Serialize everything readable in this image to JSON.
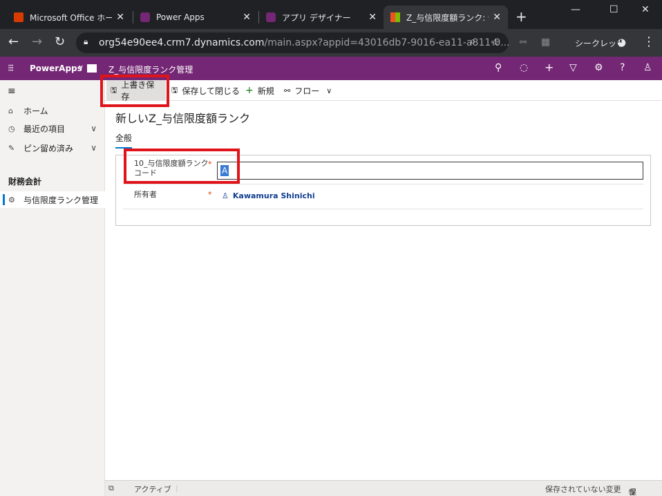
{
  "browser": {
    "tabs": [
      {
        "title": "Microsoft Office ホーム",
        "favicon_color": "#d83b01"
      },
      {
        "title": "Power Apps",
        "favicon_color": "#742774"
      },
      {
        "title": "アプリ デザイナー",
        "favicon_color": "#742774"
      },
      {
        "title": "Z_与信限度額ランク: 情",
        "favicon_color": "#f25022"
      }
    ],
    "url_host": "org54e90ee4.crm7.dynamics.com",
    "url_path": "/main.aspx?appid=43016db7-9016-ea11-a811-0...",
    "incognito_label": "シークレット"
  },
  "app": {
    "name": "PowerApps",
    "entity": "Z_与信限度ランク管理",
    "brand_color": "#742774"
  },
  "sidebar": {
    "items": [
      {
        "label": "ホーム",
        "icon": "home-icon"
      },
      {
        "label": "最近の項目",
        "icon": "clock-icon"
      },
      {
        "label": "ピン留め済み",
        "icon": "pin-icon"
      }
    ],
    "group": "財務会計",
    "entity_item": "与信限度ランク管理"
  },
  "commands": {
    "save": "上書き保存",
    "save_close": "保存して閉じる",
    "new": "新規",
    "flow": "フロー"
  },
  "form": {
    "title": "新しいZ_与信限度額ランク",
    "tab": "全般",
    "field1_label_line1": "10_与信限度額ランク",
    "field1_label_line2": "コード",
    "field1_value": "A",
    "field2_label": "所有者",
    "owner": "Kawamura Shinichi",
    "required_mark": "*"
  },
  "footer": {
    "status": "アクティブ",
    "unsaved": "保存されていない変更",
    "save": "保存"
  }
}
